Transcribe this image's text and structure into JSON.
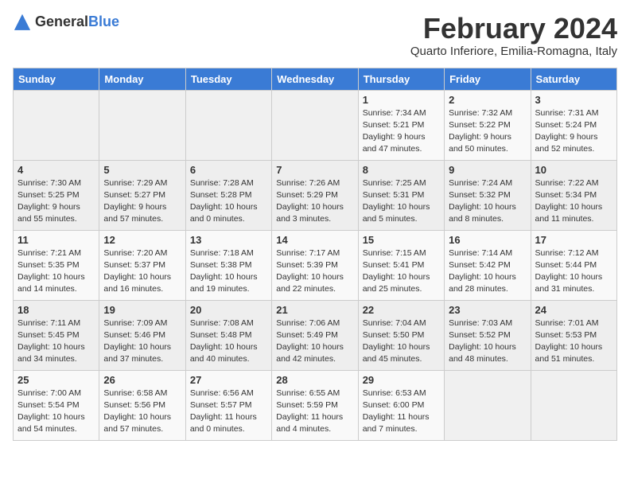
{
  "header": {
    "logo_general": "General",
    "logo_blue": "Blue",
    "month_title": "February 2024",
    "location": "Quarto Inferiore, Emilia-Romagna, Italy"
  },
  "days_of_week": [
    "Sunday",
    "Monday",
    "Tuesday",
    "Wednesday",
    "Thursday",
    "Friday",
    "Saturday"
  ],
  "weeks": [
    [
      {
        "day": "",
        "info": ""
      },
      {
        "day": "",
        "info": ""
      },
      {
        "day": "",
        "info": ""
      },
      {
        "day": "",
        "info": ""
      },
      {
        "day": "1",
        "info": "Sunrise: 7:34 AM\nSunset: 5:21 PM\nDaylight: 9 hours\nand 47 minutes."
      },
      {
        "day": "2",
        "info": "Sunrise: 7:32 AM\nSunset: 5:22 PM\nDaylight: 9 hours\nand 50 minutes."
      },
      {
        "day": "3",
        "info": "Sunrise: 7:31 AM\nSunset: 5:24 PM\nDaylight: 9 hours\nand 52 minutes."
      }
    ],
    [
      {
        "day": "4",
        "info": "Sunrise: 7:30 AM\nSunset: 5:25 PM\nDaylight: 9 hours\nand 55 minutes."
      },
      {
        "day": "5",
        "info": "Sunrise: 7:29 AM\nSunset: 5:27 PM\nDaylight: 9 hours\nand 57 minutes."
      },
      {
        "day": "6",
        "info": "Sunrise: 7:28 AM\nSunset: 5:28 PM\nDaylight: 10 hours\nand 0 minutes."
      },
      {
        "day": "7",
        "info": "Sunrise: 7:26 AM\nSunset: 5:29 PM\nDaylight: 10 hours\nand 3 minutes."
      },
      {
        "day": "8",
        "info": "Sunrise: 7:25 AM\nSunset: 5:31 PM\nDaylight: 10 hours\nand 5 minutes."
      },
      {
        "day": "9",
        "info": "Sunrise: 7:24 AM\nSunset: 5:32 PM\nDaylight: 10 hours\nand 8 minutes."
      },
      {
        "day": "10",
        "info": "Sunrise: 7:22 AM\nSunset: 5:34 PM\nDaylight: 10 hours\nand 11 minutes."
      }
    ],
    [
      {
        "day": "11",
        "info": "Sunrise: 7:21 AM\nSunset: 5:35 PM\nDaylight: 10 hours\nand 14 minutes."
      },
      {
        "day": "12",
        "info": "Sunrise: 7:20 AM\nSunset: 5:37 PM\nDaylight: 10 hours\nand 16 minutes."
      },
      {
        "day": "13",
        "info": "Sunrise: 7:18 AM\nSunset: 5:38 PM\nDaylight: 10 hours\nand 19 minutes."
      },
      {
        "day": "14",
        "info": "Sunrise: 7:17 AM\nSunset: 5:39 PM\nDaylight: 10 hours\nand 22 minutes."
      },
      {
        "day": "15",
        "info": "Sunrise: 7:15 AM\nSunset: 5:41 PM\nDaylight: 10 hours\nand 25 minutes."
      },
      {
        "day": "16",
        "info": "Sunrise: 7:14 AM\nSunset: 5:42 PM\nDaylight: 10 hours\nand 28 minutes."
      },
      {
        "day": "17",
        "info": "Sunrise: 7:12 AM\nSunset: 5:44 PM\nDaylight: 10 hours\nand 31 minutes."
      }
    ],
    [
      {
        "day": "18",
        "info": "Sunrise: 7:11 AM\nSunset: 5:45 PM\nDaylight: 10 hours\nand 34 minutes."
      },
      {
        "day": "19",
        "info": "Sunrise: 7:09 AM\nSunset: 5:46 PM\nDaylight: 10 hours\nand 37 minutes."
      },
      {
        "day": "20",
        "info": "Sunrise: 7:08 AM\nSunset: 5:48 PM\nDaylight: 10 hours\nand 40 minutes."
      },
      {
        "day": "21",
        "info": "Sunrise: 7:06 AM\nSunset: 5:49 PM\nDaylight: 10 hours\nand 42 minutes."
      },
      {
        "day": "22",
        "info": "Sunrise: 7:04 AM\nSunset: 5:50 PM\nDaylight: 10 hours\nand 45 minutes."
      },
      {
        "day": "23",
        "info": "Sunrise: 7:03 AM\nSunset: 5:52 PM\nDaylight: 10 hours\nand 48 minutes."
      },
      {
        "day": "24",
        "info": "Sunrise: 7:01 AM\nSunset: 5:53 PM\nDaylight: 10 hours\nand 51 minutes."
      }
    ],
    [
      {
        "day": "25",
        "info": "Sunrise: 7:00 AM\nSunset: 5:54 PM\nDaylight: 10 hours\nand 54 minutes."
      },
      {
        "day": "26",
        "info": "Sunrise: 6:58 AM\nSunset: 5:56 PM\nDaylight: 10 hours\nand 57 minutes."
      },
      {
        "day": "27",
        "info": "Sunrise: 6:56 AM\nSunset: 5:57 PM\nDaylight: 11 hours\nand 0 minutes."
      },
      {
        "day": "28",
        "info": "Sunrise: 6:55 AM\nSunset: 5:59 PM\nDaylight: 11 hours\nand 4 minutes."
      },
      {
        "day": "29",
        "info": "Sunrise: 6:53 AM\nSunset: 6:00 PM\nDaylight: 11 hours\nand 7 minutes."
      },
      {
        "day": "",
        "info": ""
      },
      {
        "day": "",
        "info": ""
      }
    ]
  ]
}
